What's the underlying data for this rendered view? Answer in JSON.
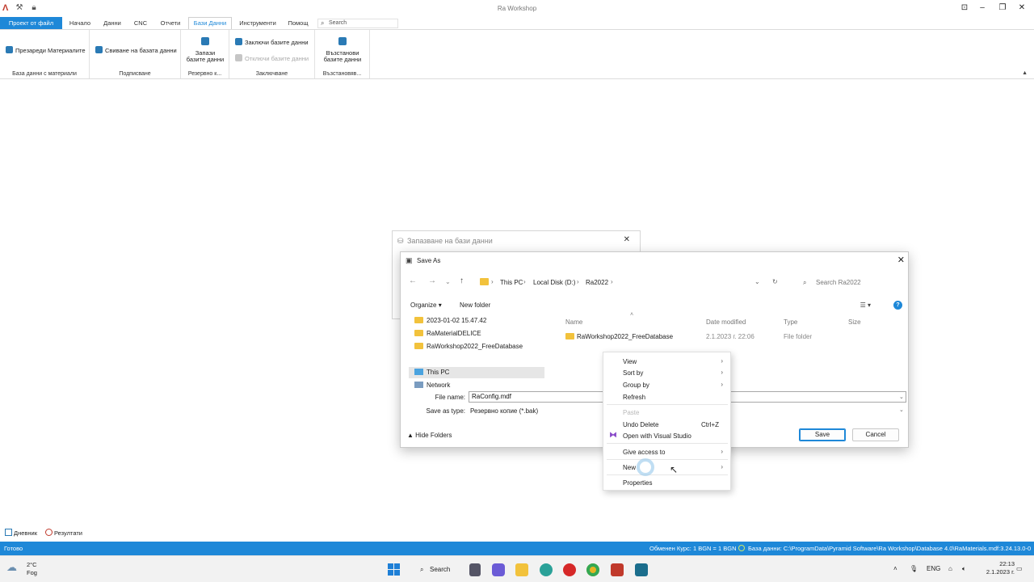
{
  "app": {
    "title": "Ra Workshop"
  },
  "ribbon_tabs": [
    {
      "label": "Проект от файл"
    },
    {
      "label": "Начало"
    },
    {
      "label": "Данни"
    },
    {
      "label": "CNC"
    },
    {
      "label": "Отчети"
    },
    {
      "label": "Бази Данни"
    },
    {
      "label": "Инструменти"
    },
    {
      "label": "Помощ"
    }
  ],
  "ribbon_search": {
    "placeholder": "Search"
  },
  "ribbon": {
    "reload_materials": "Презареди Материалите",
    "group_materials": "База данни с материали",
    "shrink_database": "Свиване на базата данни",
    "group_signing": "Подписване",
    "backup_line1": "Запази",
    "backup_line2": "базите данни",
    "group_backup": "Резервно к...",
    "lock_databases": "Заключи базите данни",
    "unlock_databases": "Отключи базите данни",
    "group_locking": "Заключване",
    "restore_line1": "Възстанови",
    "restore_line2": "базите данни",
    "group_restore": "Възстановяв..."
  },
  "bg_dialog": {
    "title": "Запазване на бази данни"
  },
  "save_as": {
    "title": "Save As",
    "breadcrumb": [
      "This PC",
      "Local Disk (D:)",
      "Ra2022"
    ],
    "search_placeholder": "Search Ra2022",
    "organize": "Organize",
    "new_folder": "New folder",
    "left_pane": [
      "2023-01-02 15.47.42",
      "RaMaterialDELICE",
      "RaWorkshop2022_FreeDatabase",
      "This PC",
      "Network"
    ],
    "columns": {
      "name": "Name",
      "date": "Date modified",
      "type": "Type",
      "size": "Size"
    },
    "files": [
      {
        "name": "RaWorkshop2022_FreeDatabase",
        "date": "2.1.2023 г. 22:06",
        "type": "File folder"
      }
    ],
    "file_name_label": "File name:",
    "file_name_value": "RaConfig.mdf",
    "save_type_label": "Save as type:",
    "save_type_value": "Резервно копие (*.bak)",
    "hide_folders": "Hide Folders",
    "save": "Save",
    "cancel": "Cancel"
  },
  "context_menu": {
    "view": "View",
    "sort_by": "Sort by",
    "group_by": "Group by",
    "refresh": "Refresh",
    "paste": "Paste",
    "undo_delete": "Undo Delete",
    "undo_shortcut": "Ctrl+Z",
    "open_vs": "Open with Visual Studio",
    "give_access": "Give access to",
    "new": "New",
    "properties": "Properties"
  },
  "bottom_tabs": {
    "journal": "Дневник",
    "results": "Резултати"
  },
  "status": {
    "ready": "Готово",
    "rate": "Обменен Курс: 1 BGN = 1 BGN",
    "database": "База данни: C:\\ProgramData\\Pyramid Software\\Ra Workshop\\Database 4.0\\RaMaterials.mdf:3.24.13.0-0"
  },
  "taskbar": {
    "temp": "2°C",
    "condition": "Fog",
    "search": "Search",
    "lang": "ENG",
    "time": "22:13",
    "date": "2.1.2023 г."
  },
  "colors": {
    "accent": "#1e88d8",
    "folder": "#f2c23c",
    "status_bar": "#1e88d8"
  }
}
